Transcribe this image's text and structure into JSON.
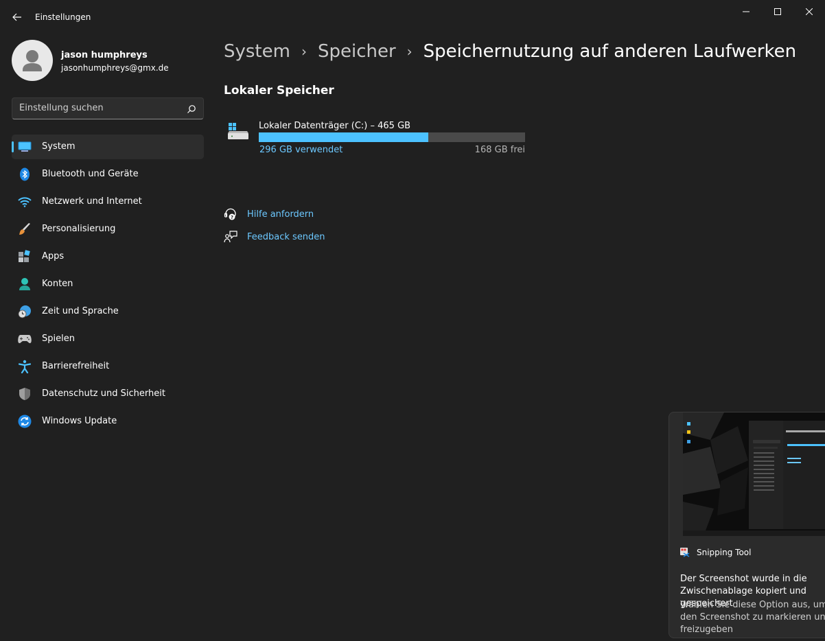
{
  "window": {
    "title": "Einstellungen"
  },
  "profile": {
    "name": "jason humphreys",
    "email": "jasonhumphreys@gmx.de"
  },
  "search": {
    "placeholder": "Einstellung suchen"
  },
  "sidebar": {
    "items": [
      {
        "label": "System",
        "icon": "system-icon",
        "active": true
      },
      {
        "label": "Bluetooth und Geräte",
        "icon": "bluetooth-icon"
      },
      {
        "label": "Netzwerk und Internet",
        "icon": "wifi-icon"
      },
      {
        "label": "Personalisierung",
        "icon": "brush-icon"
      },
      {
        "label": "Apps",
        "icon": "apps-icon"
      },
      {
        "label": "Konten",
        "icon": "account-icon"
      },
      {
        "label": "Zeit und Sprache",
        "icon": "globe-clock-icon"
      },
      {
        "label": "Spielen",
        "icon": "gamepad-icon"
      },
      {
        "label": "Barrierefreiheit",
        "icon": "accessibility-icon"
      },
      {
        "label": "Datenschutz und Sicherheit",
        "icon": "shield-icon"
      },
      {
        "label": "Windows Update",
        "icon": "update-icon"
      }
    ]
  },
  "breadcrumb": {
    "items": [
      "System",
      "Speicher",
      "Speichernutzung auf anderen Laufwerken"
    ]
  },
  "main": {
    "section_title": "Lokaler Speicher",
    "drive": {
      "label": "Lokaler Datenträger (C:) – 465 GB",
      "used_label": "296 GB verwendet",
      "free_label": "168 GB frei",
      "used_fraction": 0.6366,
      "icon": "hard-drive-icon"
    },
    "links": [
      {
        "label": "Hilfe anfordern",
        "icon": "help-icon"
      },
      {
        "label": "Feedback senden",
        "icon": "feedback-icon"
      }
    ]
  },
  "toast": {
    "app_name": "Snipping Tool",
    "title": "Der Screenshot wurde in die Zwischenablage kopiert und gespeichert",
    "body": "Wählen Sie diese Option aus, um den Screenshot zu markieren und freizugeben"
  },
  "colors": {
    "accent": "#4cc2ff",
    "link": "#6cc8ff",
    "background": "#202020"
  }
}
